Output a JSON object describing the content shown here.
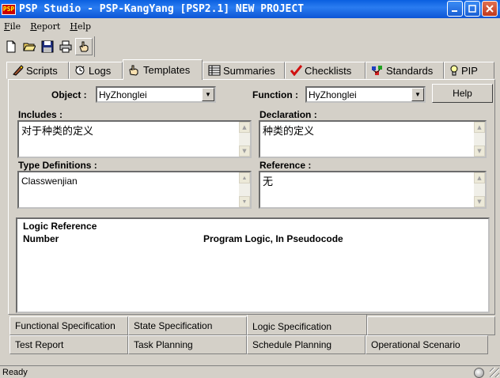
{
  "window": {
    "app_icon_text": "PSP",
    "title": "PSP Studio - PSP-KangYang [PSP2.1] NEW PROJECT"
  },
  "menu": {
    "items": [
      {
        "label": "File",
        "accel": "F"
      },
      {
        "label": "Report",
        "accel": "R"
      },
      {
        "label": "Help",
        "accel": "H"
      }
    ]
  },
  "toolbar": {
    "buttons": [
      "new-document-icon",
      "open-folder-icon",
      "save-disk-icon",
      "print-icon",
      "hand-pointer-icon"
    ]
  },
  "top_tabs": [
    {
      "label": "Scripts",
      "icon": "scripts-icon"
    },
    {
      "label": "Logs",
      "icon": "logs-icon"
    },
    {
      "label": "Templates",
      "icon": "templates-icon",
      "active": true
    },
    {
      "label": "Summaries",
      "icon": "summaries-icon"
    },
    {
      "label": "Checklists",
      "icon": "checkmark-icon"
    },
    {
      "label": "Standards",
      "icon": "standards-icon"
    },
    {
      "label": "PIP",
      "icon": "lightbulb-icon"
    }
  ],
  "form": {
    "object_label": "Object :",
    "object_value": "HyZhonglei",
    "function_label": "Function :",
    "function_value": "HyZhonglei",
    "help_label": "Help",
    "includes_label": "Includes :",
    "includes_value": "对于种类的定义",
    "declaration_label": "Declaration :",
    "declaration_value": "种类的定义",
    "type_defs_label": "Type Definitions :",
    "type_defs_value": "Classwenjian",
    "reference_label": "Reference :",
    "reference_value": "无"
  },
  "logic": {
    "col1_line1": "Logic Reference",
    "col1_line2": "Number",
    "col2": "Program Logic, In Pseudocode"
  },
  "bottom_tabs": {
    "row1": [
      "Functional Specification",
      "State Specification",
      "Logic Specification"
    ],
    "row2": [
      "Test Report",
      "Task Planning",
      "Schedule Planning",
      "Operational Scenario"
    ],
    "active": "Logic Specification"
  },
  "status": {
    "text": "Ready"
  }
}
